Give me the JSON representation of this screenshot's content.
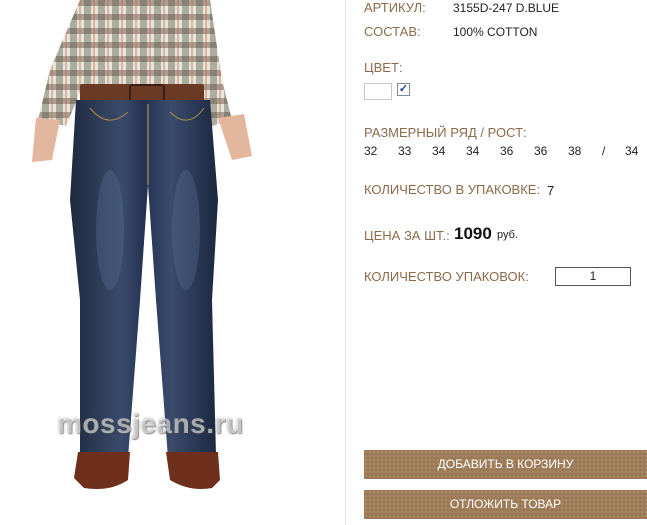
{
  "product": {
    "article_label": "АРТИКУЛ:",
    "article_value": "3155D-247 D.BLUE",
    "composition_label": "СОСТАВ:",
    "composition_value": "100% COTTON",
    "color_label": "ЦВЕТ:",
    "color_swatch": "#ffffff",
    "color_checked": "✓",
    "sizes_label": "РАЗМЕРНЫЙ РЯД / РОСТ:",
    "sizes": [
      "32",
      "33",
      "34",
      "34",
      "36",
      "36",
      "38",
      "/",
      "34"
    ],
    "pack_qty_label": "КОЛИЧЕСТВО В УПАКОВКЕ:",
    "pack_qty_value": "7",
    "price_label": "ЦЕНА ЗА ШТ.:",
    "price_value": "1090",
    "price_currency": "руб.",
    "packs_label": "КОЛИЧЕСТВО УПАКОВОК:",
    "packs_value": "1"
  },
  "actions": {
    "add_to_cart": "ДОБАВИТЬ В КОРЗИНУ",
    "postpone": "ОТЛОЖИТЬ ТОВАР"
  },
  "photo": {
    "watermark": "mossjeans.ru",
    "denim_color": "#2a3850",
    "belt_color": "#6b3a24",
    "shoe_color": "#6e2f1c"
  }
}
